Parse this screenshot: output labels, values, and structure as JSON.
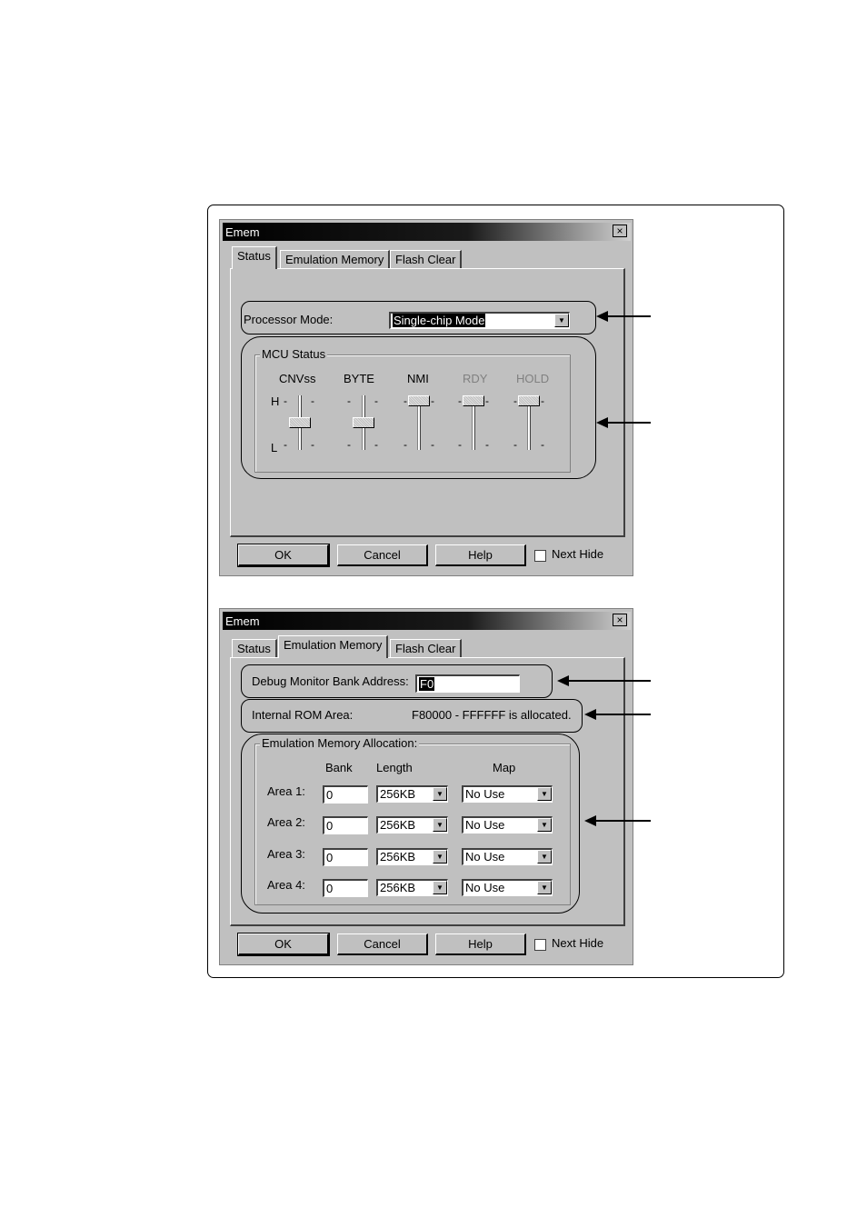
{
  "dialog_status": {
    "title": "Emem",
    "close": "×",
    "tabs": [
      "Status",
      "Emulation Memory",
      "Flash Clear"
    ],
    "processor_mode_label": "Processor Mode:",
    "processor_mode_value": "Single-chip Mode",
    "mcu_status_label": "MCU Status",
    "sliders": [
      {
        "label": "CNVss",
        "level": "L",
        "enabled": true
      },
      {
        "label": "BYTE",
        "level": "L",
        "enabled": true
      },
      {
        "label": "NMI",
        "level": "H",
        "enabled": true
      },
      {
        "label": "RDY",
        "level": "H",
        "enabled": false
      },
      {
        "label": "HOLD",
        "level": "H",
        "enabled": false
      }
    ],
    "h_label": "H",
    "l_label": "L",
    "tick": "-",
    "buttons": {
      "ok": "OK",
      "cancel": "Cancel",
      "help": "Help"
    },
    "next_hide": "Next Hide"
  },
  "dialog_emulation": {
    "title": "Emem",
    "close": "×",
    "tabs": [
      "Status",
      "Emulation Memory",
      "Flash Clear"
    ],
    "debug_monitor_label": "Debug Monitor Bank Address:",
    "debug_monitor_value": "F0",
    "internal_rom_label": "Internal ROM Area:",
    "internal_rom_value": "F80000 - FFFFFF is allocated.",
    "allocation_label": "Emulation Memory Allocation:",
    "columns": {
      "bank": "Bank",
      "length": "Length",
      "map": "Map"
    },
    "areas": [
      {
        "label": "Area 1:",
        "bank": "0",
        "length": "256KB",
        "map": "No Use"
      },
      {
        "label": "Area 2:",
        "bank": "0",
        "length": "256KB",
        "map": "No Use"
      },
      {
        "label": "Area 3:",
        "bank": "0",
        "length": "256KB",
        "map": "No Use"
      },
      {
        "label": "Area 4:",
        "bank": "0",
        "length": "256KB",
        "map": "No Use"
      }
    ],
    "buttons": {
      "ok": "OK",
      "cancel": "Cancel",
      "help": "Help"
    },
    "next_hide": "Next Hide"
  },
  "combo_arrow": "▼"
}
